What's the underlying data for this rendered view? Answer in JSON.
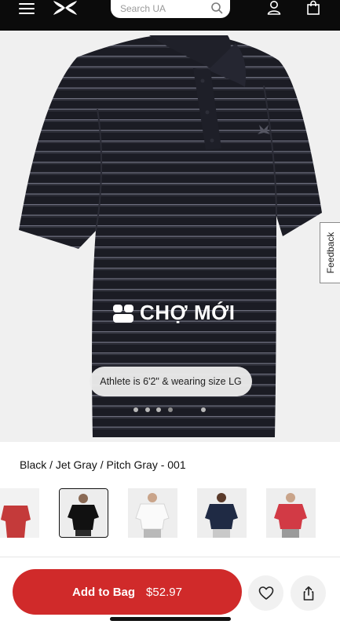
{
  "header": {
    "search_placeholder": "Search UA",
    "icons": [
      "menu-icon",
      "under-armour-logo",
      "search-icon",
      "account-icon",
      "bag-icon"
    ],
    "background_color": "#0b0b0b"
  },
  "hero": {
    "feedback_label": "Feedback",
    "watermark_text": "CHỢ MỚI",
    "athlete_info": "Athlete is 6'2\" & wearing size LG",
    "carousel": {
      "total": 5,
      "active_index": 3
    }
  },
  "product": {
    "color_name": "Black / Jet Gray / Pitch Gray - 001",
    "swatches": [
      {
        "color": "#c43a3a",
        "selected": false
      },
      {
        "color": "#111111",
        "selected": true
      },
      {
        "color": "#f5f5f5",
        "selected": false
      },
      {
        "color": "#1f2a44",
        "selected": false
      },
      {
        "color": "#d23a45",
        "selected": false
      }
    ]
  },
  "actions": {
    "add_to_bag_label": "Add to Bag",
    "price": "$52.97",
    "accent_color": "#d02a2a",
    "wishlist_icon": "heart-icon",
    "share_icon": "share-icon"
  }
}
